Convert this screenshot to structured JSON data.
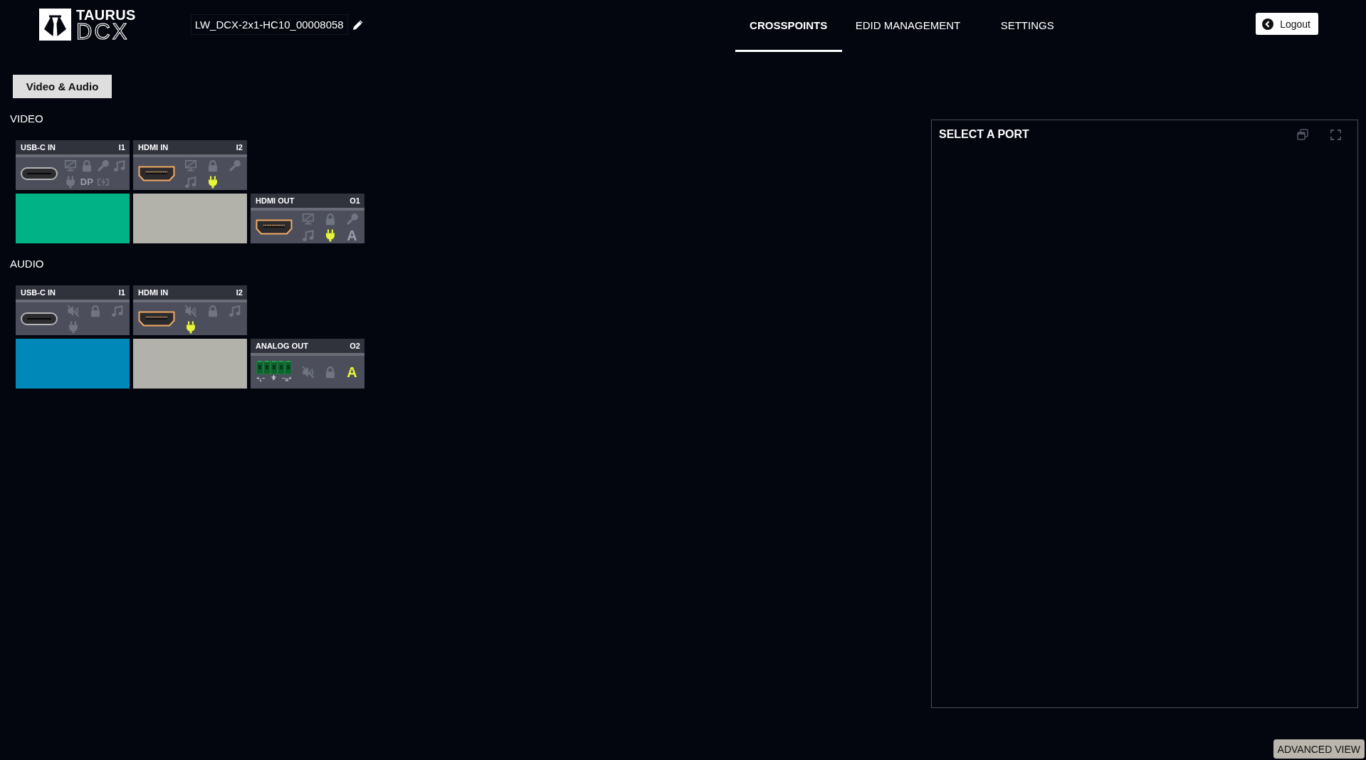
{
  "header": {
    "logo": {
      "brand": "TAURUS",
      "product": "DCX"
    },
    "device_name": "LW_DCX-2x1-HC10_00008058"
  },
  "tabs": [
    {
      "label": "CROSSPOINTS",
      "selected": true
    },
    {
      "label": "EDID MANAGEMENT",
      "selected": false
    },
    {
      "label": "SETTINGS",
      "selected": false
    }
  ],
  "logout": {
    "label": "Logout"
  },
  "view_button": {
    "label": "Video & Audio"
  },
  "sections": [
    {
      "title": "VIDEO",
      "color": "#00b386",
      "inputs": [
        {
          "name": "USB-C IN",
          "number": "I1",
          "kind": "usbc",
          "indicators": [
            {
              "kind": "monitor_off",
              "active": false
            },
            {
              "kind": "lock",
              "active": false
            },
            {
              "kind": "key",
              "active": false
            },
            {
              "kind": "note",
              "active": false
            },
            {
              "kind": "plug",
              "active": false
            },
            {
              "kind": "letter",
              "text": "DP",
              "active": false
            },
            {
              "kind": "charge",
              "active": false
            }
          ]
        },
        {
          "name": "HDMI IN",
          "number": "I2",
          "kind": "hdmi",
          "indicators": [
            {
              "kind": "monitor_off",
              "active": false
            },
            {
              "kind": "lock",
              "active": false
            },
            {
              "kind": "key",
              "active": false
            },
            {
              "kind": "note",
              "active": false
            },
            {
              "kind": "plug",
              "active": true
            }
          ]
        }
      ],
      "outputs": [
        {
          "name": "HDMI OUT",
          "number": "O1",
          "kind": "hdmi",
          "indicators": [
            {
              "kind": "monitor_off",
              "active": false
            },
            {
              "kind": "lock",
              "active": false
            },
            {
              "kind": "key",
              "active": false
            },
            {
              "kind": "note",
              "active": false
            },
            {
              "kind": "plug",
              "active": true
            },
            {
              "kind": "letter",
              "text": "A",
              "active": false
            }
          ],
          "crosspoints": [
            {
              "connected": true
            },
            {
              "connected": false
            }
          ]
        }
      ]
    },
    {
      "title": "AUDIO",
      "color": "#0088b8",
      "inputs": [
        {
          "name": "USB-C IN",
          "number": "I1",
          "kind": "usbc",
          "indicators": [
            {
              "kind": "mute",
              "active": false
            },
            {
              "kind": "lock",
              "active": false
            },
            {
              "kind": "note",
              "active": false
            },
            {
              "kind": "plug",
              "active": false
            }
          ]
        },
        {
          "name": "HDMI IN",
          "number": "I2",
          "kind": "hdmi",
          "indicators": [
            {
              "kind": "mute",
              "active": false
            },
            {
              "kind": "lock",
              "active": false
            },
            {
              "kind": "note",
              "active": false
            },
            {
              "kind": "plug",
              "active": true
            }
          ]
        }
      ],
      "outputs": [
        {
          "name": "ANALOG OUT",
          "number": "O2",
          "kind": "terminal",
          "pin_labels": [
            "+$_{L}$−",
            "−$_{R}$+"
          ],
          "indicators": [
            {
              "kind": "mute",
              "active": false
            },
            {
              "kind": "lock",
              "active": false
            },
            {
              "kind": "letter",
              "text": "A",
              "active": true
            }
          ],
          "crosspoints": [
            {
              "connected": true
            },
            {
              "connected": false
            }
          ]
        }
      ]
    }
  ],
  "panel": {
    "title": "SELECT A PORT"
  },
  "advanced_view": {
    "label": "ADVANCED VIEW"
  }
}
